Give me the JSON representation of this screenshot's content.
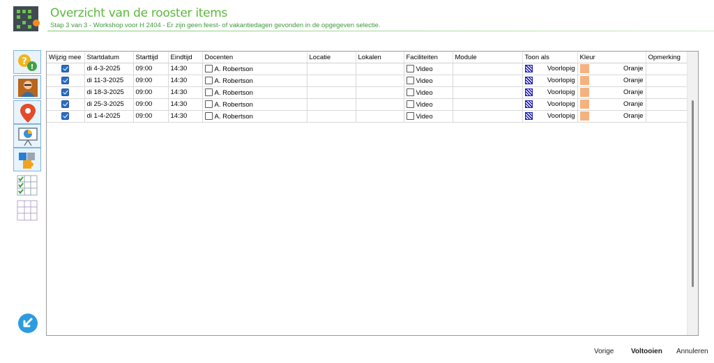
{
  "header": {
    "title": "Overzicht van de rooster items",
    "subtitle": "Stap 3 van 3 - Workshop voor H 2404 - Er zijn geen feest- of vakantiedagen gevonden in de opgegeven selectie."
  },
  "sidebar": {
    "items": [
      {
        "icon": "help-alert-icon"
      },
      {
        "icon": "teacher-icon"
      },
      {
        "icon": "location-pin-icon"
      },
      {
        "icon": "presentation-icon"
      },
      {
        "icon": "puzzle-icon"
      },
      {
        "icon": "checked-grid-icon"
      },
      {
        "icon": "empty-grid-icon"
      }
    ],
    "back_icon": "back-arrow-icon"
  },
  "grid": {
    "columns": [
      "Wijzig mee",
      "Startdatum",
      "Starttijd",
      "Eindtijd",
      "Docenten",
      "Locatie",
      "Lokalen",
      "Faciliteiten",
      "Module",
      "Toon als",
      "Kleur",
      "Opmerking"
    ],
    "rows": [
      {
        "checked": true,
        "startdatum": "di 4-3-2025",
        "starttijd": "09:00",
        "eindtijd": "14:30",
        "docent": "A. Robertson",
        "locatie": "",
        "lokalen": "",
        "faciliteit": "Video",
        "module": "",
        "toon_als": "Voorlopig",
        "kleur": "Oranje",
        "opmerking": ""
      },
      {
        "checked": true,
        "startdatum": "di 11-3-2025",
        "starttijd": "09:00",
        "eindtijd": "14:30",
        "docent": "A. Robertson",
        "locatie": "",
        "lokalen": "",
        "faciliteit": "Video",
        "module": "",
        "toon_als": "Voorlopig",
        "kleur": "Oranje",
        "opmerking": ""
      },
      {
        "checked": true,
        "startdatum": "di 18-3-2025",
        "starttijd": "09:00",
        "eindtijd": "14:30",
        "docent": "A. Robertson",
        "locatie": "",
        "lokalen": "",
        "faciliteit": "Video",
        "module": "",
        "toon_als": "Voorlopig",
        "kleur": "Oranje",
        "opmerking": ""
      },
      {
        "checked": true,
        "startdatum": "di 25-3-2025",
        "starttijd": "09:00",
        "eindtijd": "14:30",
        "docent": "A. Robertson",
        "locatie": "",
        "lokalen": "",
        "faciliteit": "Video",
        "module": "",
        "toon_als": "Voorlopig",
        "kleur": "Oranje",
        "opmerking": ""
      },
      {
        "checked": true,
        "startdatum": "di 1-4-2025",
        "starttijd": "09:00",
        "eindtijd": "14:30",
        "docent": "A. Robertson",
        "locatie": "",
        "lokalen": "",
        "faciliteit": "Video",
        "module": "",
        "toon_als": "Voorlopig",
        "kleur": "Oranje",
        "opmerking": ""
      }
    ]
  },
  "footer": {
    "prev_label": "Vorige",
    "finish_label": "Voltooien",
    "cancel_label": "Annuleren"
  },
  "colors": {
    "accent_green": "#5bb83a",
    "checkbox_blue": "#2b6cc4",
    "color_orange": "#f6b27e",
    "hatch_blue": "#1b1bb0"
  }
}
